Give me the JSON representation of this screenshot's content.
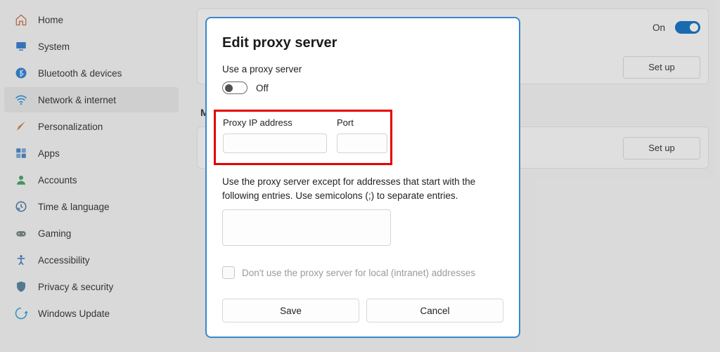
{
  "sidebar": {
    "items": [
      {
        "label": "Home",
        "icon": "home"
      },
      {
        "label": "System",
        "icon": "system"
      },
      {
        "label": "Bluetooth & devices",
        "icon": "bluetooth"
      },
      {
        "label": "Network & internet",
        "icon": "wifi",
        "selected": true
      },
      {
        "label": "Personalization",
        "icon": "brush"
      },
      {
        "label": "Apps",
        "icon": "apps"
      },
      {
        "label": "Accounts",
        "icon": "account"
      },
      {
        "label": "Time & language",
        "icon": "time"
      },
      {
        "label": "Gaming",
        "icon": "gaming"
      },
      {
        "label": "Accessibility",
        "icon": "accessibility"
      },
      {
        "label": "Privacy & security",
        "icon": "privacy"
      },
      {
        "label": "Windows Update",
        "icon": "update"
      }
    ]
  },
  "main": {
    "on_label": "On",
    "setup1_label": "Set up",
    "setup2_label": "Set up",
    "section_prefix": "M"
  },
  "dialog": {
    "title": "Edit proxy server",
    "use_proxy_label": "Use a proxy server",
    "toggle_state": "Off",
    "ip_label": "Proxy IP address",
    "ip_value": "",
    "port_label": "Port",
    "port_value": "",
    "except_label": "Use the proxy server except for addresses that start with the following entries. Use semicolons (;) to separate entries.",
    "except_value": "",
    "local_checkbox_label": "Don't use the proxy server for local (intranet) addresses",
    "local_checked": false,
    "save_label": "Save",
    "cancel_label": "Cancel"
  },
  "colors": {
    "accent": "#0067c0",
    "highlight": "#e60000",
    "dialog_border": "#3a86d0"
  }
}
